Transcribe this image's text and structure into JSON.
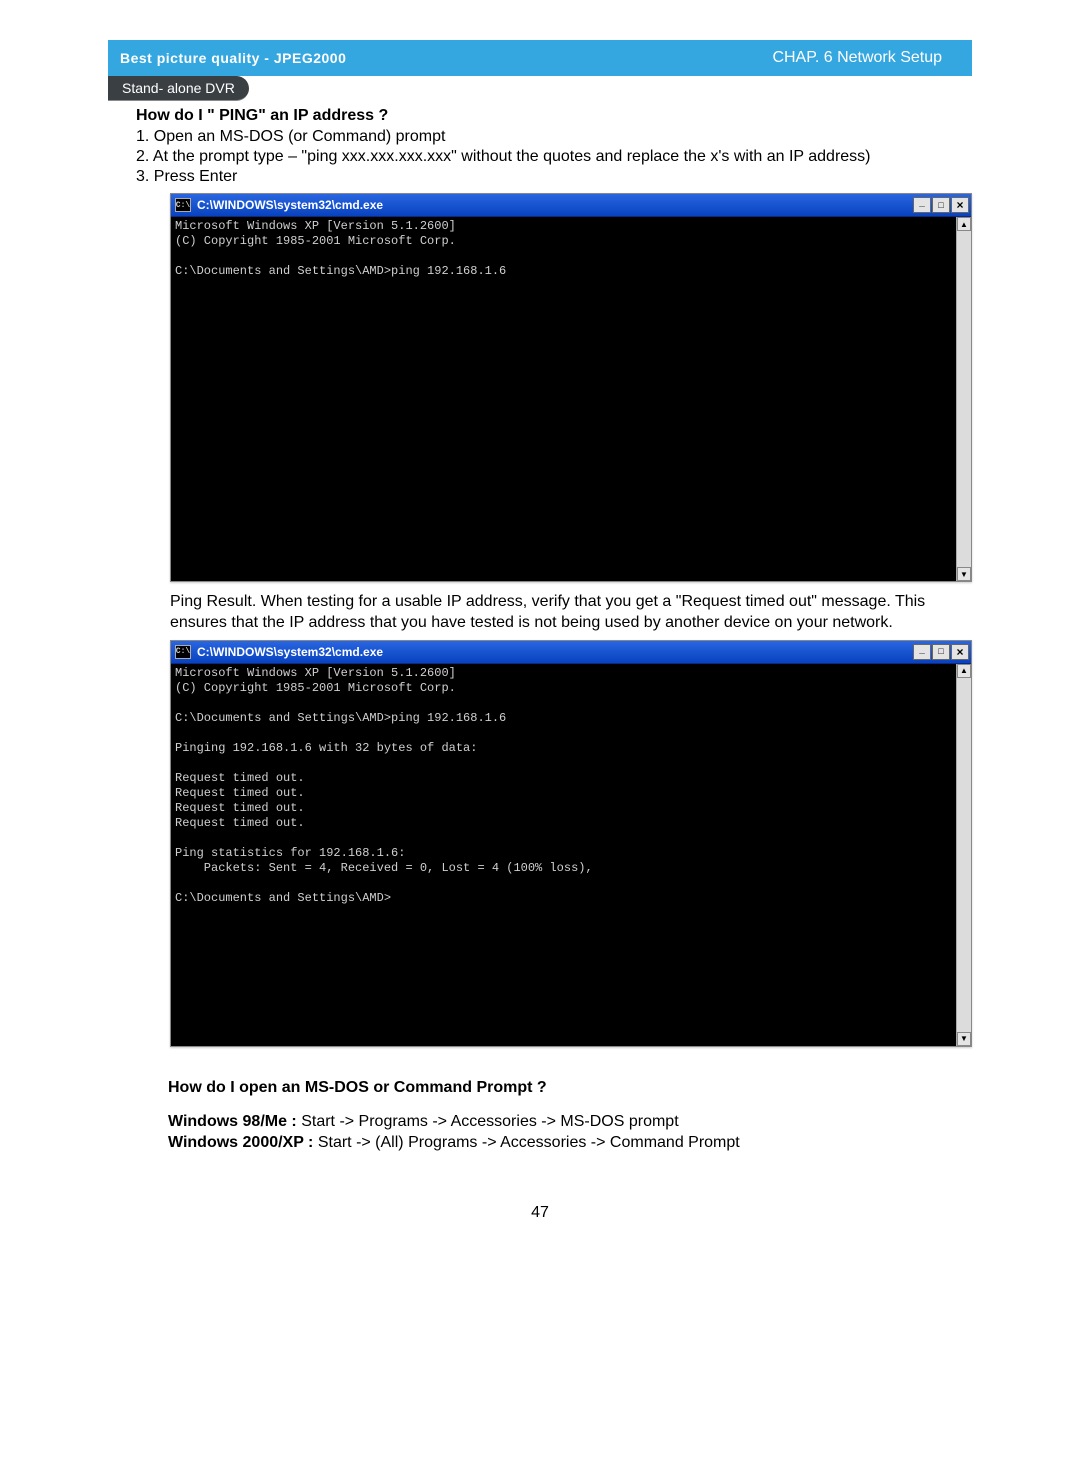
{
  "header": {
    "left": "Best picture quality - JPEG2000",
    "right": "CHAP. 6  Network Setup",
    "pill": "Stand- alone DVR"
  },
  "section1": {
    "title": "How do I  \" PING\" an IP address ?",
    "step1": "1. Open an MS-DOS (or Command) prompt",
    "step2": "2. At the prompt type – \"ping xxx.xxx.xxx.xxx\" without the quotes and replace the x's with an   IP address)",
    "step3": "3. Press Enter"
  },
  "cmd1": {
    "title": "C:\\WINDOWS\\system32\\cmd.exe",
    "iconText": "C:\\",
    "body": "Microsoft Windows XP [Version 5.1.2600]\n(C) Copyright 1985-2001 Microsoft Corp.\n\nC:\\Documents and Settings\\AMD>ping 192.168.1.6\n"
  },
  "pingResultText": "Ping Result.  When testing for a usable IP address, verify that you get a \"Request timed out\" message. This ensures that the IP address that you have tested is not being used by another device on your network.",
  "cmd2": {
    "title": "C:\\WINDOWS\\system32\\cmd.exe",
    "iconText": "C:\\",
    "body": "Microsoft Windows XP [Version 5.1.2600]\n(C) Copyright 1985-2001 Microsoft Corp.\n\nC:\\Documents and Settings\\AMD>ping 192.168.1.6\n\nPinging 192.168.1.6 with 32 bytes of data:\n\nRequest timed out.\nRequest timed out.\nRequest timed out.\nRequest timed out.\n\nPing statistics for 192.168.1.6:\n    Packets: Sent = 4, Received = 0, Lost = 4 (100% loss),\n\nC:\\Documents and Settings\\AMD>"
  },
  "section2": {
    "title": "How do I open an MS-DOS or Command Prompt ?",
    "win98label": "Windows 98/Me : ",
    "win98path": "Start -> Programs -> Accessories -> MS-DOS prompt",
    "win2klabel": "Windows 2000/XP : ",
    "win2kpath": "Start -> (All) Programs -> Accessories -> Command Prompt"
  },
  "pageNumber": "47"
}
